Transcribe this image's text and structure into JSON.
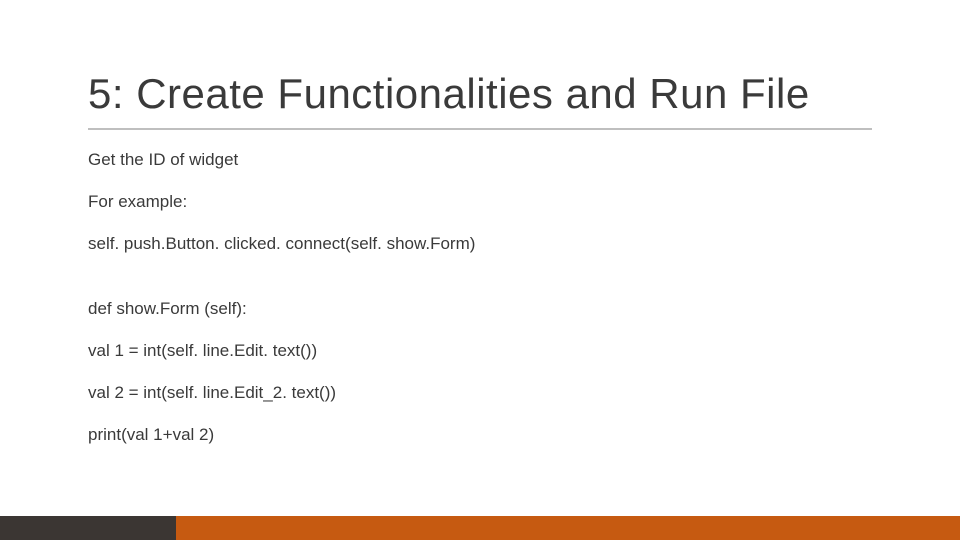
{
  "slide": {
    "title": "5: Create Functionalities and Run File",
    "lines": {
      "l1": "Get the ID of widget",
      "l2": "For example:",
      "l3": "self. push.Button. clicked. connect(self. show.Form)",
      "l4": "def show.Form (self):",
      "l5": "val 1 = int(self. line.Edit. text())",
      "l6": "val 2 = int(self. line.Edit_2. text())",
      "l7": "print(val 1+val 2)"
    }
  }
}
